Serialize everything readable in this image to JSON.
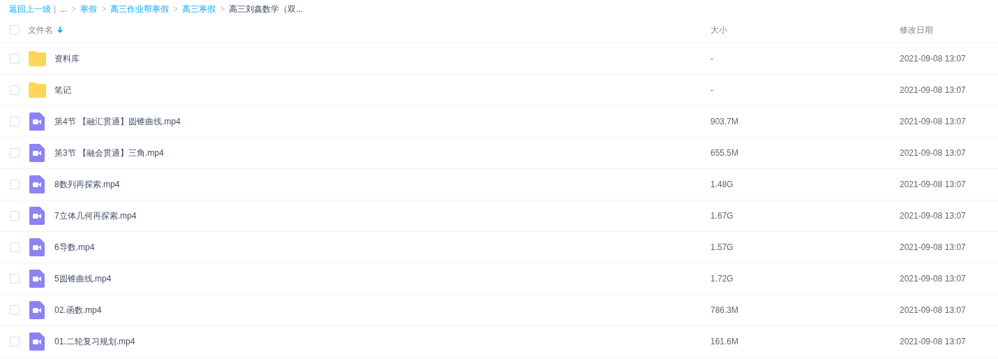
{
  "breadcrumb": [
    {
      "kind": "back",
      "label": "返回上一级"
    },
    {
      "kind": "separator",
      "label": "|"
    },
    {
      "kind": "ellipsis",
      "label": "..."
    },
    {
      "kind": "arrow",
      "label": ">"
    },
    {
      "kind": "link",
      "label": "寒假"
    },
    {
      "kind": "arrow",
      "label": ">"
    },
    {
      "kind": "link",
      "label": "高三作业帮寒假"
    },
    {
      "kind": "arrow",
      "label": ">"
    },
    {
      "kind": "link",
      "label": "高三寒假"
    },
    {
      "kind": "arrow",
      "label": ">"
    },
    {
      "kind": "current",
      "label": "高三刘鑫数学（双..."
    }
  ],
  "header": {
    "checked": false,
    "columns": [
      "文件名",
      "大小",
      "修改日期"
    ]
  },
  "files": [
    {
      "kind": "folder",
      "name": "资料库",
      "size": "-",
      "date": "2021-09-08 13:07",
      "checked": false
    },
    {
      "kind": "folder",
      "name": "笔记",
      "size": "-",
      "date": "2021-09-08 13:07",
      "checked": false
    },
    {
      "kind": "video",
      "name": "第4节 【融汇贯通】圆锥曲线.mp4",
      "size": "903.7M",
      "date": "2021-09-08 13:07",
      "checked": false
    },
    {
      "kind": "video",
      "name": "第3节 【融会贯通】三角.mp4",
      "size": "655.5M",
      "date": "2021-09-08 13:07",
      "checked": false
    },
    {
      "kind": "video",
      "name": "8数列再探索.mp4",
      "size": "1.48G",
      "date": "2021-09-08 13:07",
      "checked": false
    },
    {
      "kind": "video",
      "name": "7立体几何再探索.mp4",
      "size": "1.67G",
      "date": "2021-09-08 13:07",
      "checked": false
    },
    {
      "kind": "video",
      "name": "6导数.mp4",
      "size": "1.57G",
      "date": "2021-09-08 13:07",
      "checked": false
    },
    {
      "kind": "video",
      "name": "5圆锥曲线.mp4",
      "size": "1.72G",
      "date": "2021-09-08 13:07",
      "checked": false
    },
    {
      "kind": "video",
      "name": "02.函数.mp4",
      "size": "786.3M",
      "date": "2021-09-08 13:07",
      "checked": false
    },
    {
      "kind": "video",
      "name": "01.二轮复习规划.mp4",
      "size": "161.6M",
      "date": "2021-09-08 13:07",
      "checked": false
    }
  ]
}
